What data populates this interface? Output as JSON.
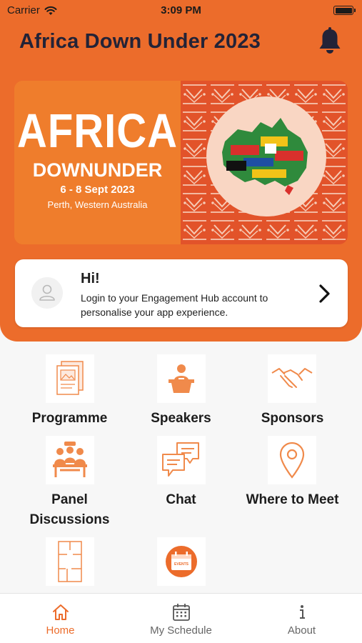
{
  "status_bar": {
    "carrier": "Carrier",
    "time": "3:09 PM"
  },
  "header": {
    "title": "Africa Down Under 2023",
    "bell_icon": "bell-icon"
  },
  "banner": {
    "word1": "AFRICA",
    "word2": "DOWNUNDER",
    "dates": "6 - 8 Sept 2023",
    "place": "Perth, Western Australia"
  },
  "login": {
    "greeting": "Hi!",
    "message": "Login to your Engagement Hub account to personalise your app experience."
  },
  "tiles": [
    {
      "label": "Programme",
      "icon": "programme-icon"
    },
    {
      "label": "Speakers",
      "icon": "speaker-icon"
    },
    {
      "label": "Sponsors",
      "icon": "handshake-icon"
    },
    {
      "label": "Panel\nDiscussions",
      "icon": "panel-discussion-icon"
    },
    {
      "label": "Chat",
      "icon": "chat-icon"
    },
    {
      "label": "Where to Meet",
      "icon": "map-pin-icon"
    },
    {
      "label": "",
      "icon": "floor-plan-icon"
    },
    {
      "label": "",
      "icon": "events-icon",
      "badge": "EVENTS"
    }
  ],
  "tabbar": {
    "tabs": [
      {
        "label": "Home",
        "icon": "home-icon",
        "active": true
      },
      {
        "label": "My Schedule",
        "icon": "calendar-icon",
        "active": false
      },
      {
        "label": "About",
        "icon": "info-icon",
        "active": false
      }
    ]
  },
  "colors": {
    "accent": "#ec6c2b",
    "title": "#232337",
    "icon_orange": "#f08a4b",
    "tab_active": "#ec6c2b",
    "tab_inactive": "#666666"
  }
}
